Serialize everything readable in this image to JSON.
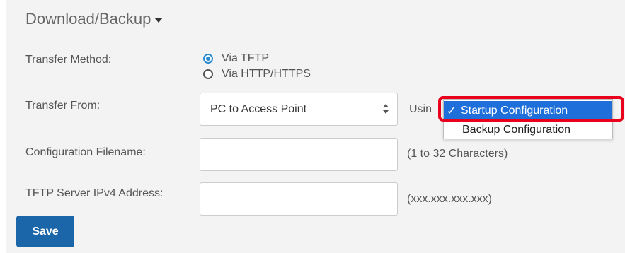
{
  "section": {
    "title": "Download/Backup"
  },
  "transfer_method": {
    "label": "Transfer Method:",
    "options": [
      {
        "label": "Via TFTP",
        "checked": true
      },
      {
        "label": "Via HTTP/HTTPS",
        "checked": false
      }
    ]
  },
  "transfer_from": {
    "label": "Transfer From:",
    "selected_value": "PC to Access Point",
    "using_label": "Usin",
    "dropdown_options": [
      {
        "label": "Startup Configuration",
        "selected": true
      },
      {
        "label": "Backup Configuration",
        "selected": false
      }
    ]
  },
  "config_filename": {
    "label": "Configuration Filename:",
    "value": "",
    "hint": "(1 to 32 Characters)"
  },
  "tftp_server": {
    "label": "TFTP Server IPv4 Address:",
    "value": "",
    "hint": "(xxx.xxx.xxx.xxx)"
  },
  "actions": {
    "save_label": "Save"
  },
  "colors": {
    "accent": "#1a66a8",
    "radio_checked": "#2a8ad0",
    "dropdown_selected": "#1e6fd9",
    "highlight": "#e8001c"
  },
  "icons": {
    "caret": "chevron-down-icon",
    "checkmark": "checkmark-icon",
    "select_arrows": "select-arrows-icon"
  }
}
